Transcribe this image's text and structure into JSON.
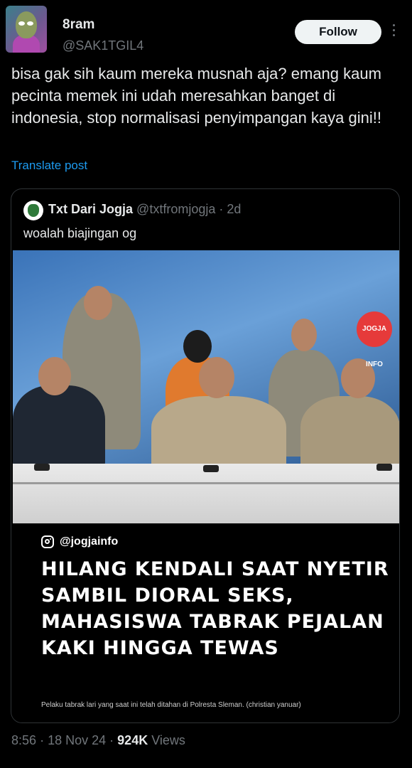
{
  "author": {
    "name": "8ram",
    "handle": "@SAK1TGIL4"
  },
  "follow_label": "Follow",
  "post_text": "bisa gak sih kaum mereka musnah aja? emang kaum pecinta memek ini udah meresahkan banget di indonesia, stop normalisasi penyimpangan kaya gini!!",
  "translate_label": "Translate post",
  "quoted": {
    "name": "Txt Dari Jogja",
    "handle": "@txtfromjogja",
    "separator": "·",
    "age": "2d",
    "text": "woalah biajingan og",
    "image": {
      "source_handle": "@jogjainfo",
      "headline": "HILANG KENDALI SAAT NYETIR SAMBIL DIORAL SEKS, MAHASISWA TABRAK PEJALAN KAKI HINGGA TEWAS",
      "caption": "Pelaku tabrak lari yang saat ini telah ditahan di Polresta Sleman. (christian yanuar)",
      "logo_text": "JOGJA INFO"
    }
  },
  "footer": {
    "time": "8:56",
    "sep1": "·",
    "date": "18 Nov 24",
    "sep2": "·",
    "views_count": "924K",
    "views_label": "Views"
  },
  "icons": {
    "more": "more-vertical-icon",
    "instagram": "instagram-icon"
  }
}
